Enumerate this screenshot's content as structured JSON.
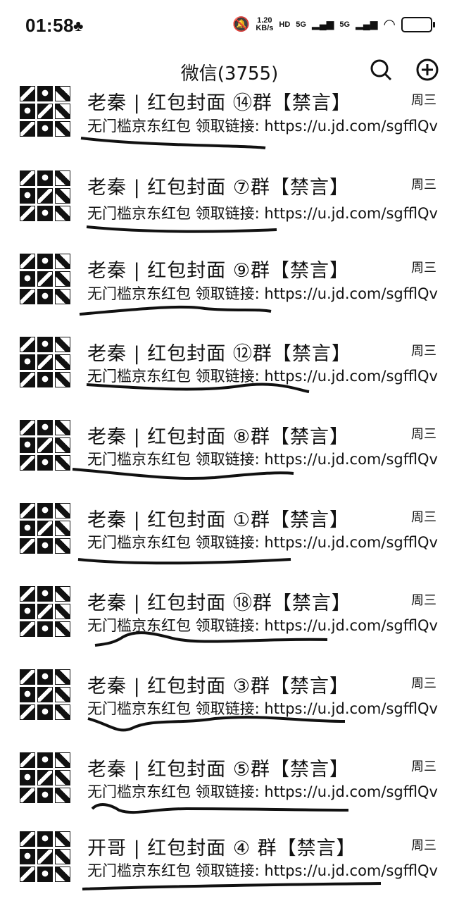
{
  "status_bar": {
    "time": "01:58",
    "speed_value": "1.20",
    "speed_unit": "KB/s",
    "hd_label": "HD",
    "network_1": "5G",
    "network_2": "5G"
  },
  "header": {
    "title": "微信(3755)"
  },
  "chats": [
    {
      "title": "老秦 | 红包封面 ⑭群【禁言】",
      "time": "周三",
      "preview": "无门槛京东红包 领取链接: https://u.jd.com/sgfflQv"
    },
    {
      "title": "老秦 | 红包封面 ⑦群【禁言】",
      "time": "周三",
      "preview": "无门槛京东红包 领取链接: https://u.jd.com/sgfflQv"
    },
    {
      "title": "老秦 | 红包封面 ⑨群【禁言】",
      "time": "周三",
      "preview": "无门槛京东红包 领取链接: https://u.jd.com/sgfflQv"
    },
    {
      "title": "老秦 | 红包封面 ⑫群【禁言】",
      "time": "周三",
      "preview": "无门槛京东红包 领取链接: https://u.jd.com/sgfflQv"
    },
    {
      "title": "老秦 | 红包封面 ⑧群【禁言】",
      "time": "周三",
      "preview": "无门槛京东红包 领取链接: https://u.jd.com/sgfflQv"
    },
    {
      "title": "老秦 | 红包封面 ①群【禁言】",
      "time": "周三",
      "preview": "无门槛京东红包 领取链接: https://u.jd.com/sgfflQv"
    },
    {
      "title": "老秦 | 红包封面 ⑱群【禁言】",
      "time": "周三",
      "preview": "无门槛京东红包 领取链接: https://u.jd.com/sgfflQv"
    },
    {
      "title": "老秦 | 红包封面 ③群【禁言】",
      "time": "周三",
      "preview": "无门槛京东红包 领取链接: https://u.jd.com/sgfflQv"
    },
    {
      "title": "老秦 | 红包封面 ⑤群【禁言】",
      "time": "周三",
      "preview": "无门槛京东红包 领取链接: https://u.jd.com/sgfflQv"
    },
    {
      "title": "开哥 | 红包封面 ④ 群【禁言】",
      "time": "周三",
      "preview": "无门槛京东红包 领取链接: https://u.jd.com/sgfflQv"
    }
  ]
}
